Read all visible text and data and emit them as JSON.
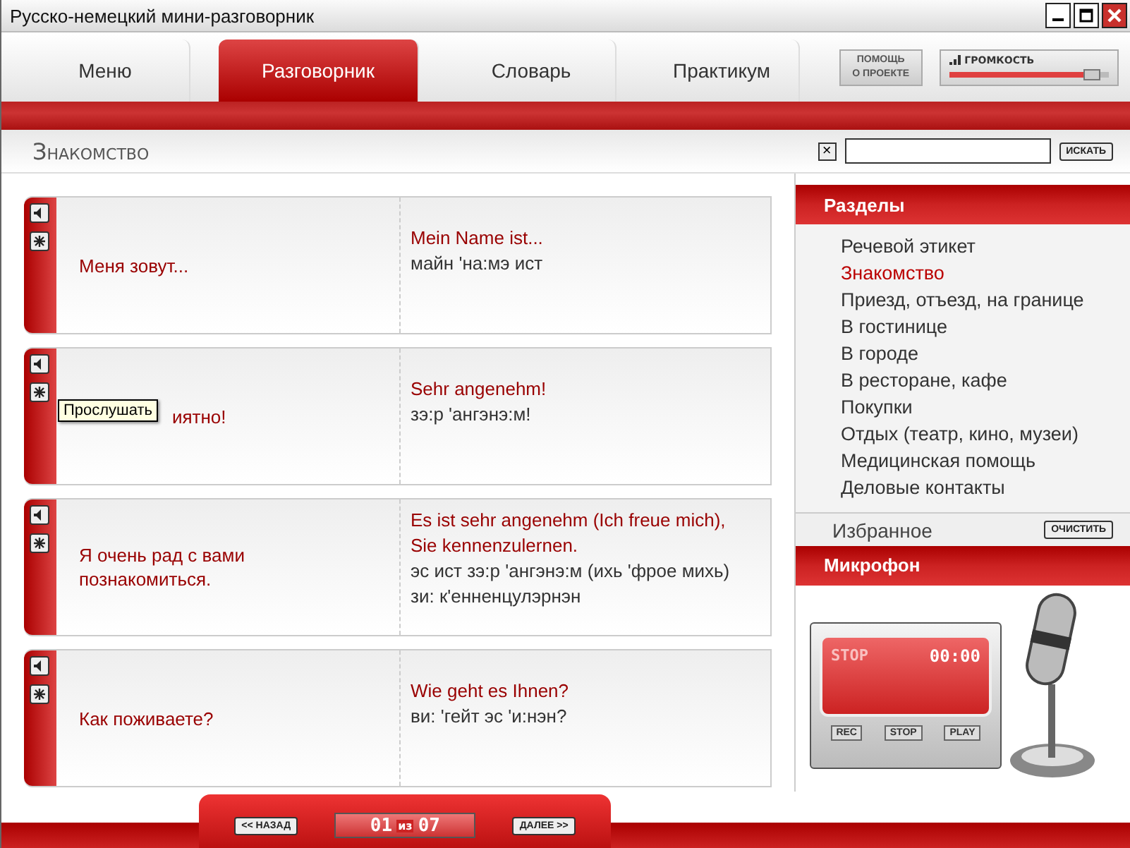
{
  "window": {
    "title": "Русско-немецкий мини-разговорник"
  },
  "tabs": [
    {
      "label": "Меню",
      "selected": false
    },
    {
      "label": "Разговорник",
      "selected": true
    },
    {
      "label": "Словарь",
      "selected": false
    },
    {
      "label": "Практикум",
      "selected": false
    }
  ],
  "header_buttons": {
    "help": [
      "ПОМОЩЬ",
      "О ПРОЕКТЕ"
    ],
    "volume": {
      "label": "ГРОМКОСТЬ",
      "level": 0.95
    }
  },
  "heading": "Знакомство",
  "search": {
    "clear": "×",
    "button": "ИСКАТЬ"
  },
  "phrases": [
    {
      "russian": "Меня зовут...",
      "german": "Mein Name ist...",
      "transcription": "майн 'на:мэ ист"
    },
    {
      "russian": "иятно!",
      "german": "Sehr angenehm!",
      "transcription": "зэ:р 'ангэнэ:м!",
      "tooltip": "Прослушать"
    },
    {
      "russian": "Я очень рад с вами познакомиться.",
      "german": "Es ist sehr angenehm (Ich freue mich), Sie kennenzulernen.",
      "transcription": "эс ист зэ:р 'ангэнэ:м (ихь 'фрое михь) зи: к'енненцулэрнэн"
    },
    {
      "russian": "Как поживаете?",
      "german": "Wie geht es Ihnen?",
      "transcription": "ви: 'гейт эс 'и:нэн?"
    }
  ],
  "sections": {
    "title": "Разделы",
    "items": [
      {
        "label": "Речевой этикет",
        "selected": false
      },
      {
        "label": "Знакомство",
        "selected": true
      },
      {
        "label": "Приезд, отъезд, на границе",
        "selected": false
      },
      {
        "label": "В гостинице",
        "selected": false
      },
      {
        "label": "В городе",
        "selected": false
      },
      {
        "label": "В ресторане, кафе",
        "selected": false
      },
      {
        "label": "Покупки",
        "selected": false
      },
      {
        "label": "Отдых (театр, кино, музеи)",
        "selected": false
      },
      {
        "label": "Медицинская помощь",
        "selected": false
      },
      {
        "label": "Деловые контакты",
        "selected": false
      }
    ]
  },
  "favorites": {
    "label": "Избранное",
    "button": "ОЧИСТИТЬ"
  },
  "microphone": {
    "title": "Микрофон",
    "status": "STOP",
    "time": "00:00",
    "buttons": [
      "REC",
      "STOP",
      "PLAY"
    ]
  },
  "pager": {
    "prev": "<< НАЗАД",
    "current": "01",
    "of": "из",
    "total": "07",
    "next": "ДАЛЕЕ >>"
  }
}
